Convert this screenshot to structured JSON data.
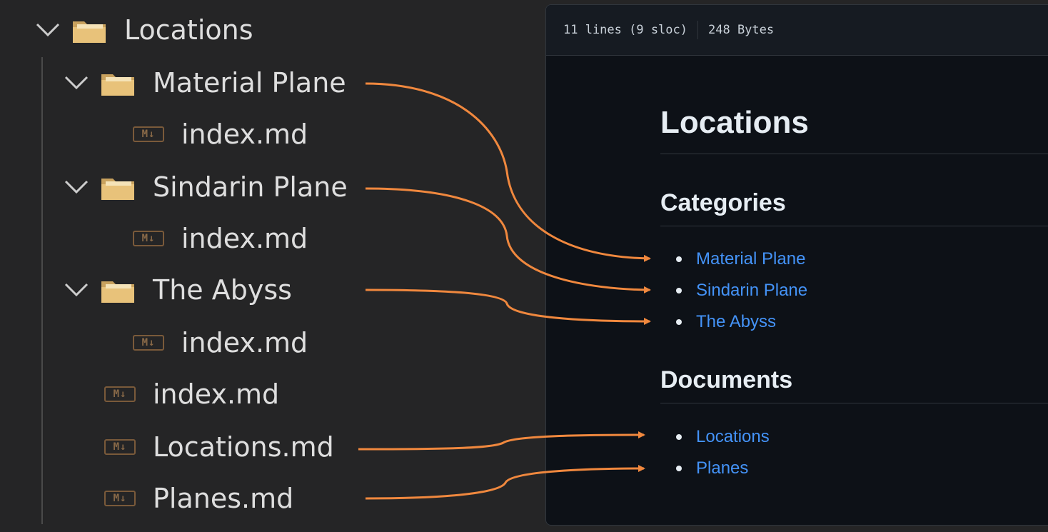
{
  "explorer": {
    "root": {
      "label": "Locations"
    },
    "material_plane": {
      "label": "Material Plane",
      "child": "index.md"
    },
    "sindarin_plane": {
      "label": "Sindarin Plane",
      "child": "index.md"
    },
    "the_abyss": {
      "label": "The Abyss",
      "child": "index.md"
    },
    "files": [
      "index.md",
      "Locations.md",
      "Planes.md"
    ],
    "md_badge": "M↓"
  },
  "preview": {
    "lines": "11 lines (9 sloc)",
    "size": "248 Bytes",
    "title": "Locations",
    "categories": {
      "heading": "Categories",
      "links": [
        "Material Plane",
        "Sindarin Plane",
        "The Abyss"
      ]
    },
    "documents": {
      "heading": "Documents",
      "links": [
        "Locations",
        "Planes"
      ]
    }
  },
  "colors": {
    "arrow": "#f0883e",
    "link": "#4493f8",
    "folder": "#e8c27a"
  }
}
